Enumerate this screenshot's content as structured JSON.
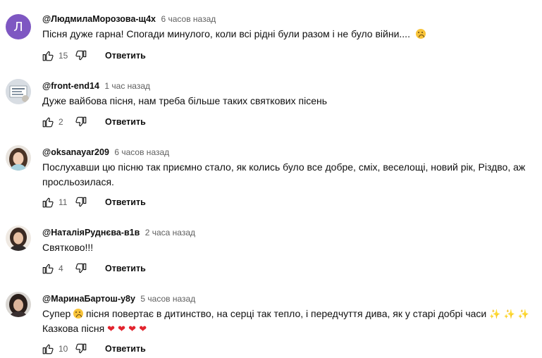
{
  "comments": [
    {
      "avatar_letter": "Л",
      "author": "@ЛюдмилаМорозова-щ4х",
      "time": "6 часов назад",
      "text_a": "Пісня дуже гарна! Спогади минулого, коли всі рідні були разом і не було війни....",
      "likes": "15",
      "reply": "Ответить"
    },
    {
      "author": "@front-end14",
      "time": "1 час назад",
      "text_a": "Дуже вайбова пісня, нам треба більше таких святкових пісень",
      "likes": "2",
      "reply": "Ответить"
    },
    {
      "author": "@oksanayar209",
      "time": "6 часов назад",
      "text_a": "Послухавши цю пісню так приємно стало, як колись було все добре, сміх, веселощі, новий рік, Різдво, аж просльозилася.",
      "likes": "11",
      "reply": "Ответить"
    },
    {
      "author": "@НаталіяРуднєва-в1в",
      "time": "2 часа назад",
      "text_a": "Святково!!!",
      "likes": "4",
      "reply": "Ответить"
    },
    {
      "author": "@МаринаБартош-у8у",
      "time": "5 часов назад",
      "text_a": "Супер",
      "text_b": "пісня повертає в дитинство, на серці так тепло, і передчуття дива, як у старі добрі часи",
      "text_c": "Казкова пісня",
      "likes": "10",
      "reply": "Ответить"
    }
  ],
  "icons": {
    "like": "thumb-up-icon",
    "dislike": "thumb-down-icon",
    "sad": "crying-face-emoji",
    "sparkles": "sparkles-emoji",
    "heart": "red-heart-emoji"
  },
  "colors": {
    "avatar_letter_bg": "#7e57c2",
    "meta_text": "#606060",
    "heart": "#e2242e"
  }
}
